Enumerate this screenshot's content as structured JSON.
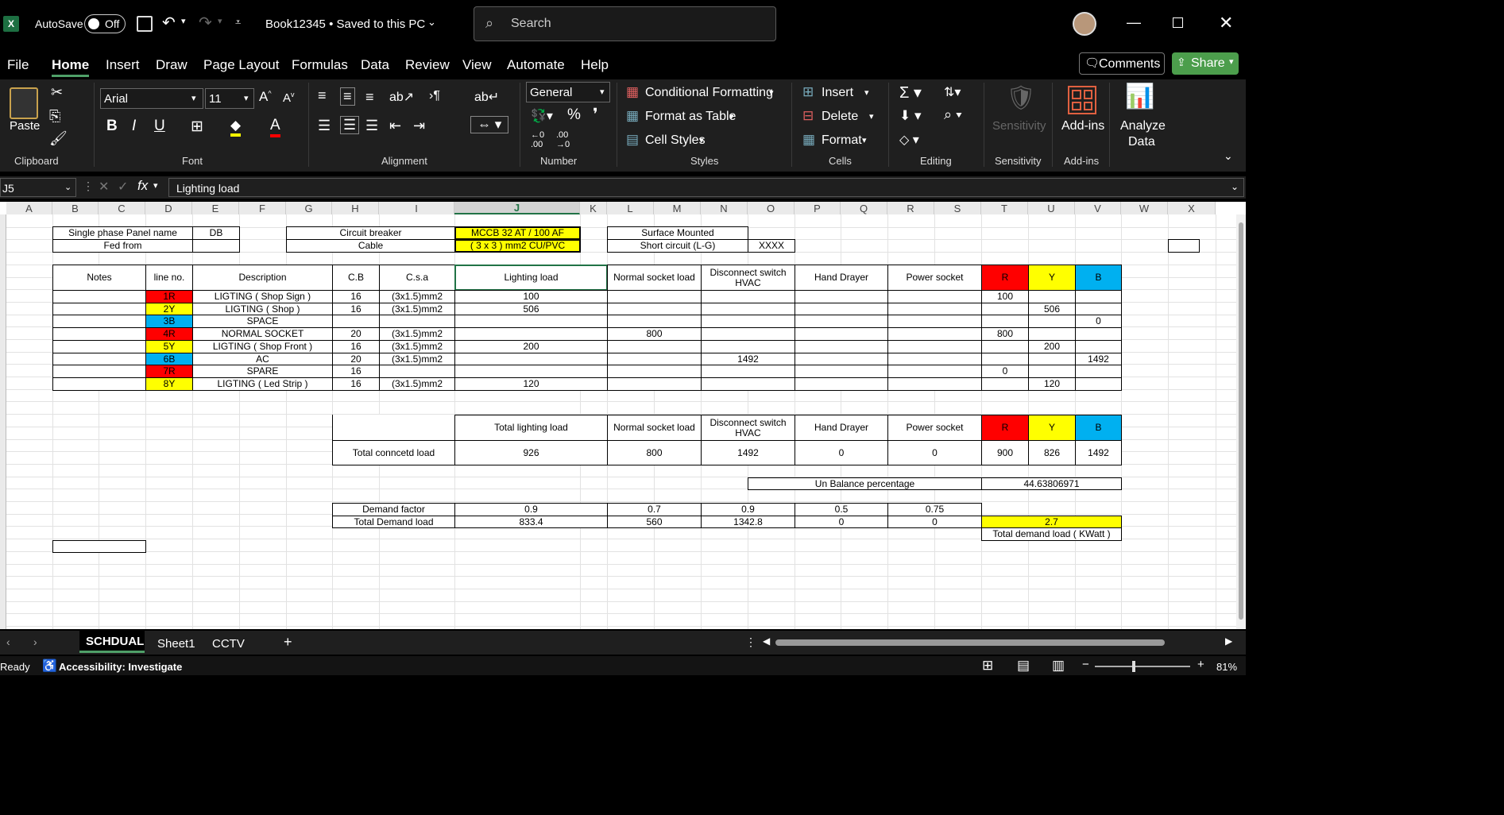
{
  "titlebar": {
    "autosave_label": "AutoSave",
    "autosave_state": "Off",
    "doc_title": "Book12345 • Saved to this PC",
    "search_placeholder": "Search"
  },
  "menu": {
    "items": [
      "File",
      "Home",
      "Insert",
      "Draw",
      "Page Layout",
      "Formulas",
      "Data",
      "Review",
      "View",
      "Automate",
      "Help"
    ],
    "comments": "Comments",
    "share": "Share"
  },
  "ribbon": {
    "paste": "Paste",
    "font_name": "Arial",
    "font_size": "11",
    "number_format": "General",
    "conditional_formatting": "Conditional Formatting",
    "format_as_table": "Format as Table",
    "cell_styles": "Cell Styles",
    "insert": "Insert",
    "delete": "Delete",
    "format": "Format",
    "sensitivity": "Sensitivity",
    "add_ins": "Add-ins",
    "analyze": "Analyze",
    "analyze2": "Data",
    "groups": {
      "clipboard": "Clipboard",
      "font": "Font",
      "alignment": "Alignment",
      "number": "Number",
      "styles": "Styles",
      "cells": "Cells",
      "editing": "Editing",
      "sensitivity": "Sensitivity",
      "addins": "Add-ins"
    }
  },
  "formula_bar": {
    "name_box": "J5",
    "formula": "Lighting load"
  },
  "columns": [
    "A",
    "B",
    "C",
    "D",
    "E",
    "F",
    "G",
    "H",
    "I",
    "J",
    "K",
    "L",
    "M",
    "N",
    "O",
    "P",
    "Q",
    "R",
    "S",
    "T",
    "U",
    "V",
    "W",
    "X"
  ],
  "sheet": {
    "panel_name_label": "Single phase Panel name",
    "panel_name_value": "DB",
    "fed_from_label": "Fed from",
    "breaker_label": "Circuit breaker",
    "breaker_value": "MCCB 32 AT / 100 AF",
    "cable_label": "Cable",
    "cable_value": "( 3 x 3 ) mm2  CU/PVC",
    "mount": "Surface Mounted",
    "short_circuit_label": "Short circuit (L-G)",
    "short_circuit_value": "XXXX",
    "headers": [
      "Notes",
      "line no.",
      "Description",
      "C.B",
      "C.s.a",
      "Lighting load",
      "Normal socket load",
      "Disconnect switch HVAC",
      "Hand Drayer",
      "Power socket",
      "R",
      "Y",
      "B"
    ],
    "rows": [
      {
        "line": "1R",
        "desc": "LIGTING ( Shop Sign )",
        "cb": "16",
        "csa": "(3x1.5)mm2",
        "light": "100",
        "sock": "",
        "hvac": "",
        "r": "100",
        "y": "",
        "b": ""
      },
      {
        "line": "2Y",
        "desc": "LIGTING ( Shop )",
        "cb": "16",
        "csa": "(3x1.5)mm2",
        "light": "506",
        "sock": "",
        "hvac": "",
        "r": "",
        "y": "506",
        "b": ""
      },
      {
        "line": "3B",
        "desc": "SPACE",
        "cb": "",
        "csa": "",
        "light": "",
        "sock": "",
        "hvac": "",
        "r": "",
        "y": "",
        "b": "0"
      },
      {
        "line": "4R",
        "desc": "NORMAL SOCKET",
        "cb": "20",
        "csa": "(3x1.5)mm2",
        "light": "",
        "sock": "800",
        "hvac": "",
        "r": "800",
        "y": "",
        "b": ""
      },
      {
        "line": "5Y",
        "desc": "LIGTING ( Shop Front )",
        "cb": "16",
        "csa": "(3x1.5)mm2",
        "light": "200",
        "sock": "",
        "hvac": "",
        "r": "",
        "y": "200",
        "b": ""
      },
      {
        "line": "6B",
        "desc": "AC",
        "cb": "20",
        "csa": "(3x1.5)mm2",
        "light": "",
        "sock": "",
        "hvac": "1492",
        "r": "",
        "y": "",
        "b": "1492"
      },
      {
        "line": "7R",
        "desc": "SPARE",
        "cb": "16",
        "csa": "",
        "light": "",
        "sock": "",
        "hvac": "",
        "r": "0",
        "y": "",
        "b": ""
      },
      {
        "line": "8Y",
        "desc": "LIGTING  ( Led Strip )",
        "cb": "16",
        "csa": "(3x1.5)mm2",
        "light": "120",
        "sock": "",
        "hvac": "",
        "r": "",
        "y": "120",
        "b": ""
      }
    ],
    "total_headers": [
      "Total lighting load",
      "Normal socket load",
      "Disconnect switch HVAC",
      "Hand Drayer",
      "Power socket",
      "R",
      "Y",
      "B"
    ],
    "total_label": "Total conncetd load",
    "total_values": [
      "926",
      "800",
      "1492",
      "0",
      "0",
      "900",
      "826",
      "1492"
    ],
    "unbalance_label": "Un Balance percentage",
    "unbalance_value": "44.63806971",
    "demand_factor_label": "Demand factor",
    "demand_factors": [
      "0.9",
      "0.7",
      "0.9",
      "0.5",
      "0.75"
    ],
    "total_demand_label": "Total Demand load",
    "total_demands": [
      "833.4",
      "560",
      "1342.8",
      "0",
      "0"
    ],
    "total_kw": "2.7",
    "total_kw_label": "Total demand load  ( KWatt )"
  },
  "sheet_tabs": [
    "SCHDUAL",
    "Sheet1",
    "CCTV"
  ],
  "status": {
    "ready": "Ready",
    "accessibility": "Accessibility: Investigate",
    "zoom": "81%"
  },
  "colors": {
    "red": "#ff0000",
    "yellow": "#ffff00",
    "blue": "#00b0f0",
    "share_green": "#4c9e4c"
  }
}
